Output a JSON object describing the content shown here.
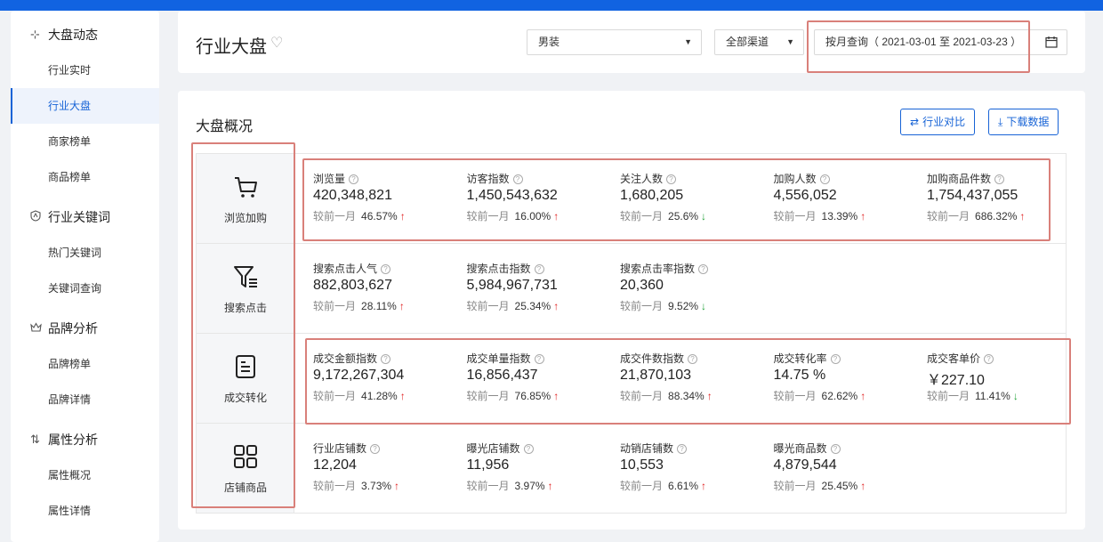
{
  "sidebar": {
    "groups": [
      {
        "icon": "pin-icon",
        "label": "大盘动态",
        "items": [
          "行业实时",
          "行业大盘",
          "商家榜单",
          "商品榜单"
        ]
      },
      {
        "icon": "shield-icon",
        "label": "行业关键词",
        "items": [
          "热门关键词",
          "关键词查询"
        ]
      },
      {
        "icon": "crown-icon",
        "label": "品牌分析",
        "items": [
          "品牌榜单",
          "品牌详情"
        ]
      },
      {
        "icon": "sort-icon",
        "label": "属性分析",
        "items": [
          "属性概况",
          "属性详情"
        ]
      }
    ],
    "active": "行业大盘"
  },
  "header": {
    "title": "行业大盘",
    "category_select": "男装",
    "channel_select": "全部渠道",
    "date_range": "按月查询（ 2021-03-01 至 2021-03-23 ）"
  },
  "main": {
    "section_title": "大盘概况",
    "compare_button": "行业对比",
    "download_button": "下载数据",
    "compare_prefix": "较前一月",
    "rows": [
      {
        "label": "浏览加购",
        "icon": "cart-icon",
        "metrics": [
          {
            "name": "浏览量",
            "value": "420,348,821",
            "change": "46.57%",
            "dir": "up"
          },
          {
            "name": "访客指数",
            "value": "1,450,543,632",
            "change": "16.00%",
            "dir": "up"
          },
          {
            "name": "关注人数",
            "value": "1,680,205",
            "change": "25.6%",
            "dir": "down"
          },
          {
            "name": "加购人数",
            "value": "4,556,052",
            "change": "13.39%",
            "dir": "up"
          },
          {
            "name": "加购商品件数",
            "value": "1,754,437,055",
            "change": "686.32%",
            "dir": "up"
          }
        ]
      },
      {
        "label": "搜索点击",
        "icon": "filter-icon",
        "metrics": [
          {
            "name": "搜索点击人气",
            "value": "882,803,627",
            "change": "28.11%",
            "dir": "up"
          },
          {
            "name": "搜索点击指数",
            "value": "5,984,967,731",
            "change": "25.34%",
            "dir": "up"
          },
          {
            "name": "搜索点击率指数",
            "value": "20,360",
            "change": "9.52%",
            "dir": "down"
          }
        ]
      },
      {
        "label": "成交转化",
        "icon": "document-icon",
        "metrics": [
          {
            "name": "成交金额指数",
            "value": "9,172,267,304",
            "change": "41.28%",
            "dir": "up"
          },
          {
            "name": "成交单量指数",
            "value": "16,856,437",
            "change": "76.85%",
            "dir": "up"
          },
          {
            "name": "成交件数指数",
            "value": "21,870,103",
            "change": "88.34%",
            "dir": "up"
          },
          {
            "name": "成交转化率",
            "value": "14.75 %",
            "change": "62.62%",
            "dir": "up"
          },
          {
            "name": "成交客单价",
            "value": "￥227.10",
            "change": "11.41%",
            "dir": "down"
          }
        ]
      },
      {
        "label": "店铺商品",
        "icon": "grid-icon",
        "metrics": [
          {
            "name": "行业店铺数",
            "value": "12,204",
            "change": "3.73%",
            "dir": "up"
          },
          {
            "name": "曝光店铺数",
            "value": "11,956",
            "change": "3.97%",
            "dir": "up"
          },
          {
            "name": "动销店铺数",
            "value": "10,553",
            "change": "6.61%",
            "dir": "up"
          },
          {
            "name": "曝光商品数",
            "value": "4,879,544",
            "change": "25.45%",
            "dir": "up"
          }
        ]
      }
    ]
  },
  "colors": {
    "accent": "#1763d6",
    "up": "#e02020",
    "down": "#23a33a",
    "highlight": "#d9807a"
  }
}
